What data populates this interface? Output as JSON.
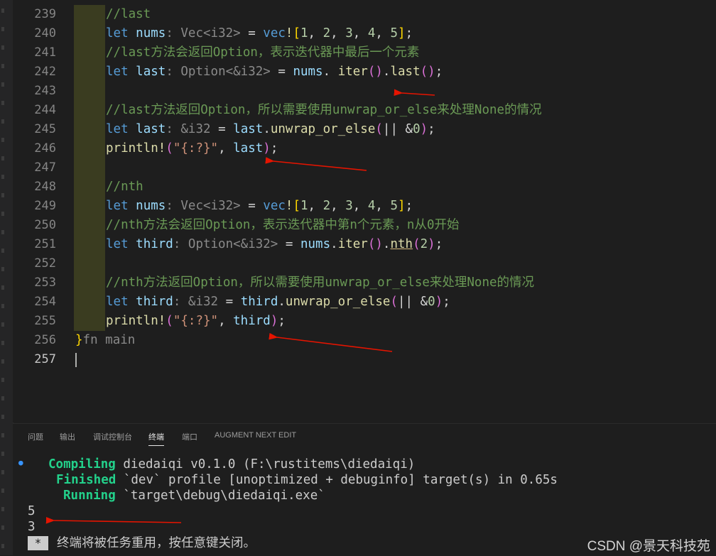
{
  "editor": {
    "lines": [
      {
        "no": "239",
        "segments": [
          [
            "cm",
            "//last"
          ]
        ]
      },
      {
        "no": "240",
        "segments": [
          [
            "kw",
            "let "
          ],
          [
            "var",
            "nums"
          ],
          [
            "ty",
            ": Vec<i32>"
          ],
          [
            "",
            "= "
          ],
          [
            "kw",
            "vec"
          ],
          [
            "fn",
            "!"
          ],
          [
            "bracket1",
            "["
          ],
          [
            "num",
            "1"
          ],
          [
            "",
            ", "
          ],
          [
            "num",
            "2"
          ],
          [
            "",
            ", "
          ],
          [
            "num",
            "3"
          ],
          [
            "",
            ", "
          ],
          [
            "num",
            "4"
          ],
          [
            "",
            ", "
          ],
          [
            "num",
            "5"
          ],
          [
            "bracket1",
            "]"
          ],
          [
            "",
            ";"
          ]
        ]
      },
      {
        "no": "241",
        "segments": [
          [
            "cm",
            "//last方法会返回Option，表示迭代器中最后一个元素"
          ]
        ]
      },
      {
        "no": "242",
        "segments": [
          [
            "kw",
            "let "
          ],
          [
            "var",
            "last"
          ],
          [
            "ty",
            ": Option<&i32>"
          ],
          [
            "",
            ""
          ],
          [
            "",
            "= "
          ],
          [
            "var",
            "nums"
          ],
          [
            "",
            ". "
          ],
          [
            "fn",
            "iter"
          ],
          [
            "bracket2",
            "()"
          ],
          [
            "",
            "."
          ],
          [
            "fn",
            "last"
          ],
          [
            "bracket2",
            "()"
          ],
          [
            "",
            ";"
          ]
        ]
      },
      {
        "no": "243",
        "segments": []
      },
      {
        "no": "244",
        "segments": [
          [
            "cm",
            "//last方法返回Option，所以需要使用unwrap_or_else来处理None的情况"
          ]
        ]
      },
      {
        "no": "245",
        "segments": [
          [
            "kw",
            "let "
          ],
          [
            "var",
            "last"
          ],
          [
            "ty",
            ": &i32"
          ],
          [
            "",
            ""
          ],
          [
            "",
            "= "
          ],
          [
            "var",
            "last"
          ],
          [
            "",
            "."
          ],
          [
            "fn",
            "unwrap_or_else"
          ],
          [
            "bracket2",
            "("
          ],
          [
            "",
            "|| &"
          ],
          [
            "num",
            "0"
          ],
          [
            "bracket2",
            ")"
          ],
          [
            "",
            ";"
          ]
        ]
      },
      {
        "no": "246",
        "segments": [
          [
            "fn",
            "println!"
          ],
          [
            "bracket2",
            "("
          ],
          [
            "str",
            "\"{:?}\""
          ],
          [
            "",
            ", "
          ],
          [
            "var",
            "last"
          ],
          [
            "bracket2",
            ")"
          ],
          [
            "",
            ";"
          ]
        ]
      },
      {
        "no": "247",
        "segments": []
      },
      {
        "no": "248",
        "segments": [
          [
            "cm",
            "//nth"
          ]
        ]
      },
      {
        "no": "249",
        "segments": [
          [
            "kw",
            "let "
          ],
          [
            "var",
            "nums"
          ],
          [
            "ty",
            ": Vec<i32>"
          ],
          [
            "",
            "= "
          ],
          [
            "kw",
            "vec"
          ],
          [
            "fn",
            "!"
          ],
          [
            "bracket1",
            "["
          ],
          [
            "num",
            "1"
          ],
          [
            "",
            ", "
          ],
          [
            "num",
            "2"
          ],
          [
            "",
            ", "
          ],
          [
            "num",
            "3"
          ],
          [
            "",
            ", "
          ],
          [
            "num",
            "4"
          ],
          [
            "",
            ", "
          ],
          [
            "num",
            "5"
          ],
          [
            "bracket1",
            "]"
          ],
          [
            "",
            ";"
          ]
        ]
      },
      {
        "no": "250",
        "segments": [
          [
            "cm",
            "//nth方法会返回Option，表示迭代器中第n个元素，n从0开始"
          ]
        ]
      },
      {
        "no": "251",
        "segments": [
          [
            "kw",
            "let "
          ],
          [
            "var",
            "third"
          ],
          [
            "ty",
            ": Option<&i32>"
          ],
          [
            "",
            "= "
          ],
          [
            "var",
            "nums"
          ],
          [
            "",
            "."
          ],
          [
            "fn",
            "iter"
          ],
          [
            "bracket2",
            "()"
          ],
          [
            "",
            "."
          ],
          [
            "fn",
            "nth"
          ],
          [
            "bracket2",
            "("
          ],
          [
            "num",
            "2"
          ],
          [
            "bracket2",
            ")"
          ],
          [
            "",
            ";"
          ]
        ]
      },
      {
        "no": "252",
        "segments": []
      },
      {
        "no": "253",
        "segments": [
          [
            "cm",
            "//nth方法返回Option，所以需要使用unwrap_or_else来处理None的情况"
          ]
        ]
      },
      {
        "no": "254",
        "segments": [
          [
            "kw",
            "let "
          ],
          [
            "var",
            "third"
          ],
          [
            "ty",
            ": &i32"
          ],
          [
            "",
            "= "
          ],
          [
            "var",
            "third"
          ],
          [
            "",
            "."
          ],
          [
            "fn",
            "unwrap_or_else"
          ],
          [
            "bracket2",
            "("
          ],
          [
            "",
            "|| &"
          ],
          [
            "num",
            "0"
          ],
          [
            "bracket2",
            ")"
          ],
          [
            "",
            ";"
          ]
        ]
      },
      {
        "no": "255",
        "segments": [
          [
            "fn",
            "println!"
          ],
          [
            "bracket2",
            "("
          ],
          [
            "str",
            "\"{:?}\""
          ],
          [
            "",
            ", "
          ],
          [
            "var",
            "third"
          ],
          [
            "bracket2",
            ")"
          ],
          [
            "",
            ";"
          ]
        ]
      },
      {
        "no": "256",
        "segments": [
          [
            "bracket1",
            "}"
          ],
          [
            "ghost",
            "fn main"
          ]
        ]
      },
      {
        "no": "257",
        "segments": []
      }
    ]
  },
  "panel": {
    "tabs": [
      "问题",
      "输出",
      "调试控制台",
      "终端",
      "端口",
      "AUGMENT NEXT EDIT"
    ],
    "active_tab": "终端",
    "terminal": {
      "compiling_label": "Compiling",
      "compiling_text": "diedaiqi v0.1.0 (F:\\rustitems\\diedaiqi)",
      "finished_label": "Finished",
      "finished_text": "`dev` profile [unoptimized + debuginfo] target(s) in 0.65s",
      "running_label": "Running",
      "running_text": "`target\\debug\\diedaiqi.exe`",
      "output_1": "5",
      "output_2": "3",
      "prompt_symbol": "*",
      "prompt_text": "终端将被任务重用，按任意键关闭。"
    }
  },
  "watermark": "CSDN @景天科技苑",
  "colors": {
    "annotation_arrow": "#e51400",
    "terminal_green": "#23d18b"
  }
}
